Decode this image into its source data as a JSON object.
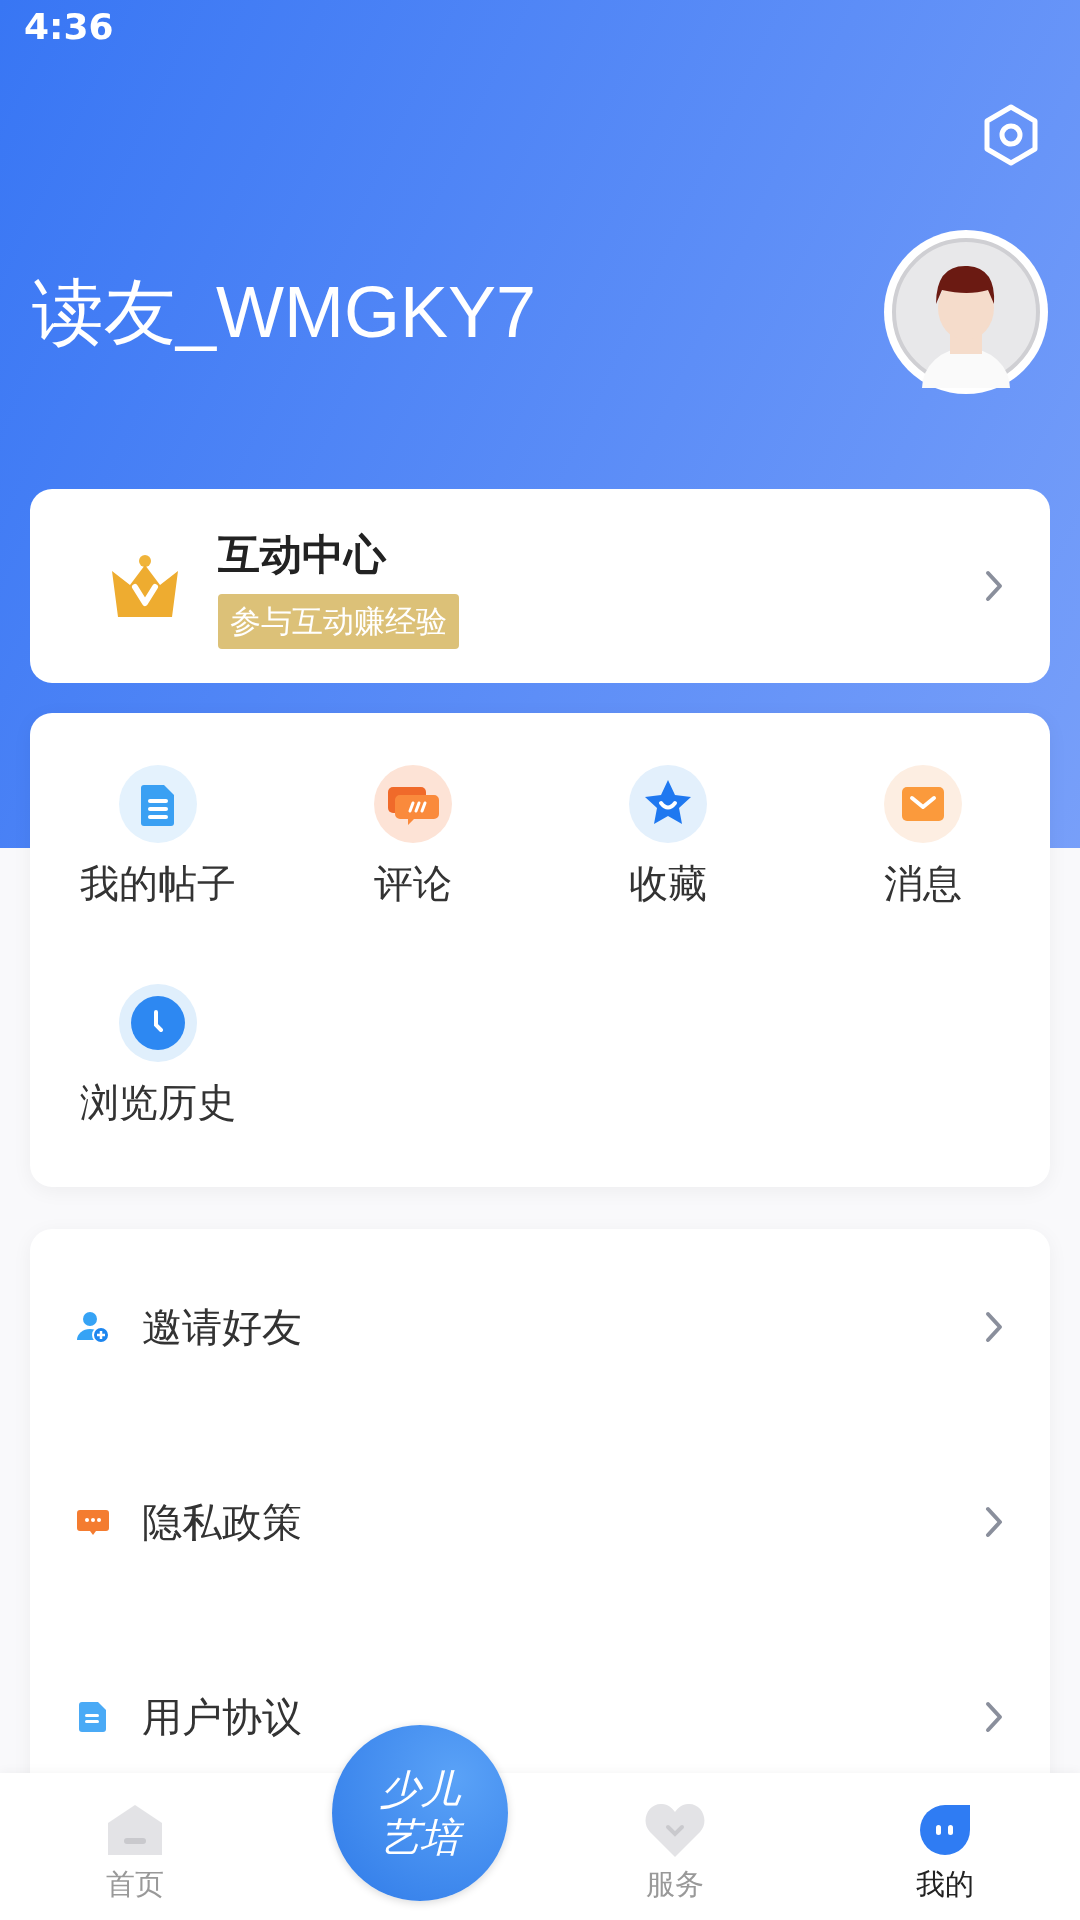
{
  "status_bar": {
    "time": "4:36"
  },
  "profile": {
    "username": "读友_WMGKY7"
  },
  "interaction_card": {
    "title": "互动中心",
    "badge": "参与互动赚经验"
  },
  "shortcuts": [
    {
      "label": "我的帖子",
      "kind": "posts"
    },
    {
      "label": "评论",
      "kind": "comments"
    },
    {
      "label": "收藏",
      "kind": "favorites"
    },
    {
      "label": "消息",
      "kind": "messages"
    },
    {
      "label": "浏览历史",
      "kind": "history"
    }
  ],
  "menu": [
    {
      "label": "邀请好友",
      "kind": "invite"
    },
    {
      "label": "隐私政策",
      "kind": "privacy"
    },
    {
      "label": "用户协议",
      "kind": "agreement"
    }
  ],
  "bottom_nav": [
    {
      "label": "首页",
      "kind": "home",
      "selected": false
    },
    {
      "label": "少儿艺培",
      "kind": "logo"
    },
    {
      "label": "服务",
      "kind": "service",
      "selected": false
    },
    {
      "label": "我的",
      "kind": "me",
      "selected": true
    }
  ]
}
